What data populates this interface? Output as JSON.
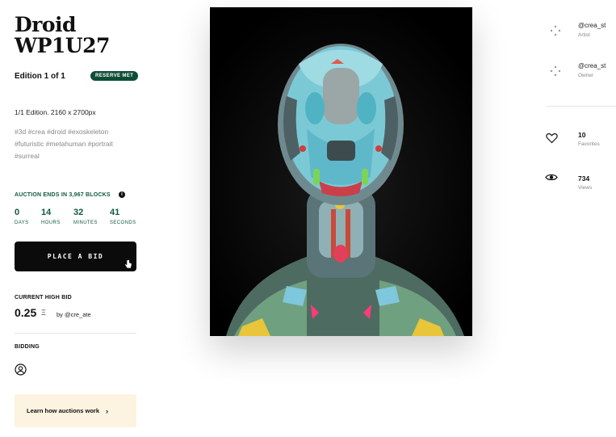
{
  "artwork": {
    "title_line1": "Droid",
    "title_line2": "WP1U27",
    "edition": "Edition 1 of 1",
    "reserve_badge": "RESERVE MET",
    "dimensions": "1/1 Edition. 2160 x 2700px",
    "tags_line1": "#3d #crea #droid #exoskeleton",
    "tags_line2": "#futuristic #metahuman #portrait",
    "tags_line3": "#surreal"
  },
  "auction": {
    "ends_label": "AUCTION ENDS IN 3,967 BLOCKS",
    "info_icon": "info-icon",
    "countdown": [
      {
        "value": "0",
        "label": "DAYS"
      },
      {
        "value": "14",
        "label": "HOURS"
      },
      {
        "value": "32",
        "label": "MINUTES"
      },
      {
        "value": "41",
        "label": "SECONDS"
      }
    ],
    "bid_button": "PLACE A BID",
    "cursor_icon": "hand-pointer-icon"
  },
  "current_bid": {
    "label": "CURRENT HIGH BID",
    "amount": "0.25",
    "currency_symbol": "Ξ",
    "bidder": "by @cre_ate"
  },
  "bidding": {
    "label": "BIDDING",
    "icon": "user-circle-icon"
  },
  "learn": {
    "text": "Learn how auctions work",
    "chevron": "›"
  },
  "people": {
    "artist": {
      "handle": "@crea_st",
      "role": "Artist"
    },
    "owner": {
      "handle": "@crea_st",
      "role": "Owner"
    }
  },
  "stats": {
    "favorites": {
      "value": "10",
      "label": "Favorites",
      "icon": "heart-icon"
    },
    "views": {
      "value": "734",
      "label": "Views",
      "icon": "eye-icon"
    }
  },
  "colors": {
    "accent_green": "#0f5a3c",
    "badge_green": "#0f4d36",
    "learn_bg": "#fdf3e1"
  }
}
